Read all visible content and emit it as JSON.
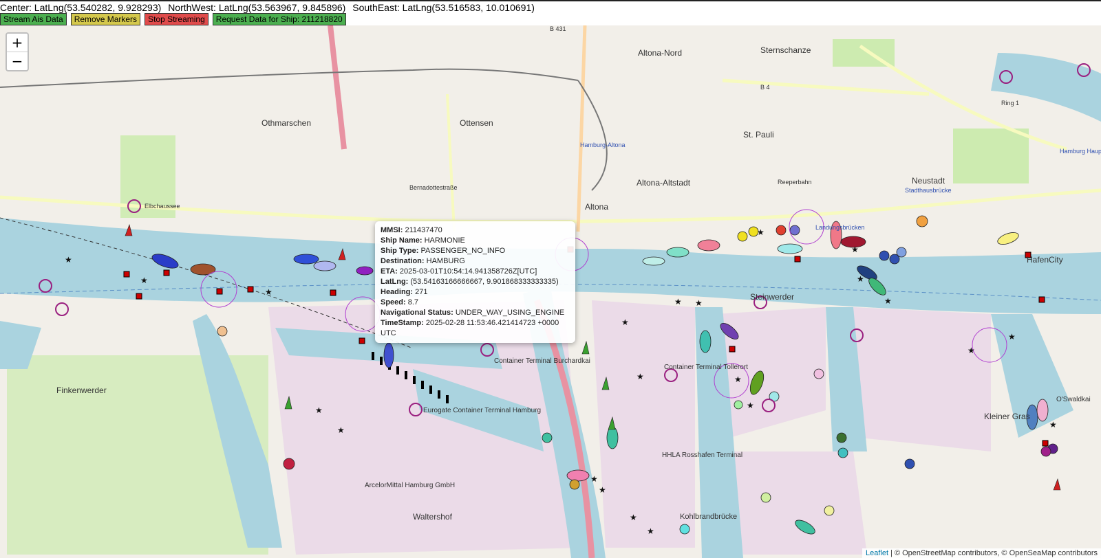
{
  "header": {
    "center": "Center: LatLng(53.540282, 9.928293)",
    "northwest": "NorthWest: LatLng(53.563967, 9.845896)",
    "southeast": "SouthEast: LatLng(53.516583, 10.010691)"
  },
  "controls": {
    "stream": {
      "label": "Stream Ais Data",
      "color": "#4caf50"
    },
    "remove": {
      "label": "Remove Markers",
      "color": "#d4c84c"
    },
    "stop": {
      "label": "Stop Streaming",
      "color": "#e04b4b"
    },
    "request": {
      "label": "Request Data for Ship: 211218820",
      "color": "#4caf50"
    }
  },
  "zoom": {
    "in": "+",
    "out": "−"
  },
  "popup": {
    "mmsi_label": "MMSI:",
    "mmsi": "211437470",
    "name_label": "Ship Name:",
    "name": "HARMONIE",
    "type_label": "Ship Type:",
    "type": "PASSENGER_NO_INFO",
    "dest_label": "Destination:",
    "dest": "HAMBURG",
    "eta_label": "ETA:",
    "eta": "2025-03-01T10:54:14.941358726Z[UTC]",
    "latlng_label": "LatLng:",
    "latlng": "(53.54163166666667, 9.901868333333335)",
    "heading_label": "Heading:",
    "heading": "271",
    "speed_label": "Speed:",
    "speed": "8.7",
    "nav_label": "Navigational Status:",
    "nav": "UNDER_WAY_USING_ENGINE",
    "ts_label": "TimeStamp:",
    "ts": "2025-02-28 11:53:46.421414723 +0000 UTC"
  },
  "map_labels": {
    "altona_nord": "Altona-Nord",
    "sternschanze": "Sternschanze",
    "ottensen": "Ottensen",
    "othmarschen": "Othmarschen",
    "st_pauli": "St. Pauli",
    "neustadt": "Neustadt",
    "altona_altstadt": "Altona-Altstadt",
    "altona": "Altona",
    "hafencity": "HafenCity",
    "finkenwerder": "Finkenwerder",
    "waltershof": "Waltershof",
    "steinwerder": "Steinwerder",
    "kleiner_grasbrook": "Kleiner Gras",
    "container_burchardkai": "Container Terminal Burchardkai",
    "eurogate": "Eurogate Container Terminal Hamburg",
    "container_tollerort": "Container Terminal Tollerort",
    "hhla_rosshafen": "HHLA Rosshafen Terminal",
    "arcelormittal": "ArcelorMittal Hamburg GmbH",
    "kohlbrandbruecke": "Kohlbrandbrücke",
    "elbchaussee": "Elbchaussee",
    "bernadottestrasse": "Bernadottestraße",
    "hamburg_altona": "Hamburg-Altona",
    "reeperbahn": "Reeperbahn",
    "stadthausbruecke": "Stadthausbrücke",
    "hamburg_hbf": "Hamburg Hauptbahnhof",
    "landungsbruecken": "Landungsbrücken",
    "ring1": "Ring 1",
    "b431": "B 431",
    "b4": "B 4",
    "o_swaldkai": "O'Swaldkai"
  },
  "attribution": {
    "leaflet": "Leaflet",
    "text": " | © OpenStreetMap contributors, © OpenSeaMap contributors"
  },
  "colors": {
    "water": "#aad3df",
    "land": "#f2efe9",
    "industrial": "#ebdbe8",
    "park": "#cdebb0",
    "rail": "#e892a2"
  }
}
